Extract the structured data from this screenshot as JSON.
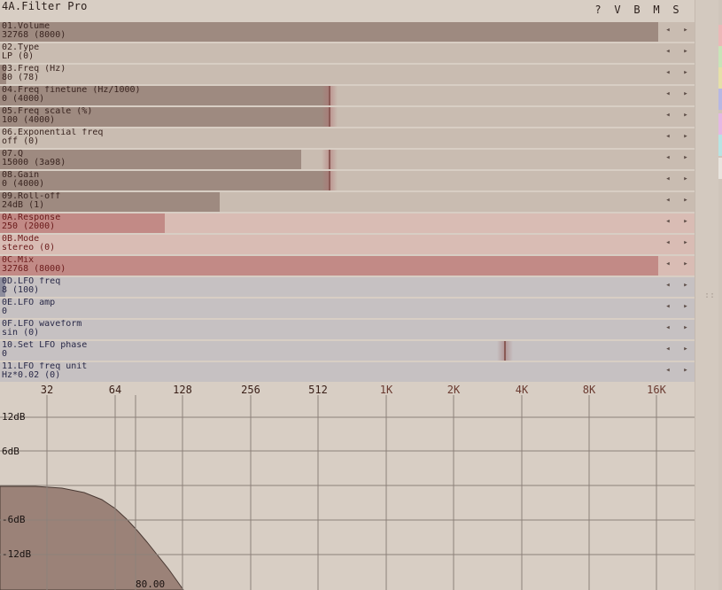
{
  "window": {
    "title": "4A.Filter Pro",
    "buttons": [
      "?",
      "V",
      "B",
      "M",
      "S"
    ]
  },
  "colors": {
    "bg": "#d8cec4",
    "brown_bg": "#c9bcb1",
    "brown_fill": "#9e8a80",
    "red_bg": "#d9bcb4",
    "red_fill": "#c28a86",
    "blue_bg": "#c6c1c2",
    "blue_fill": "#8e8e9e",
    "brown_text": "#3a2520",
    "red_text": "#6a1a1a",
    "blue_text": "#2a2a48",
    "curve": "#9b8278"
  },
  "params": [
    {
      "name": "01.Volume",
      "value": "32768 (8000)",
      "group": "brown",
      "level": 0.948
    },
    {
      "name": "02.Type",
      "value": "LP (0)",
      "group": "brown",
      "level": 0
    },
    {
      "name": "03.Freq (Hz)",
      "value": "80 (78)",
      "group": "brown",
      "level": 0.009
    },
    {
      "name": "04.Freq finetune (Hz/1000)",
      "value": "0 (4000)",
      "group": "brown",
      "level": 0.475,
      "marker": 0.475
    },
    {
      "name": "05.Freq scale (%)",
      "value": "100 (4000)",
      "group": "brown",
      "level": 0.475,
      "marker": 0.475
    },
    {
      "name": "06.Exponential freq",
      "value": "off (0)",
      "group": "brown",
      "level": 0
    },
    {
      "name": "07.Q",
      "value": "15000 (3a98)",
      "group": "brown",
      "level": 0.434,
      "marker": 0.475
    },
    {
      "name": "08.Gain",
      "value": "0 (4000)",
      "group": "brown",
      "level": 0.475,
      "marker": 0.475
    },
    {
      "name": "09.Roll-off",
      "value": "24dB (1)",
      "group": "brown",
      "level": 0.316
    },
    {
      "name": "0A.Response",
      "value": "250 (2000)",
      "group": "red",
      "level": 0.237
    },
    {
      "name": "0B.Mode",
      "value": "stereo (0)",
      "group": "red",
      "level": 0
    },
    {
      "name": "0C.Mix",
      "value": "32768 (8000)",
      "group": "red",
      "level": 0.948
    },
    {
      "name": "0D.LFO freq",
      "value": "8 (100)",
      "group": "blue",
      "level": 0.008
    },
    {
      "name": "0E.LFO amp",
      "value": "0",
      "group": "blue",
      "level": 0
    },
    {
      "name": "0F.LFO waveform",
      "value": "sin (0)",
      "group": "blue",
      "level": 0
    },
    {
      "name": "10.Set LFO phase",
      "value": "0",
      "group": "blue",
      "level": 0,
      "marker": 0.727
    },
    {
      "name": "11.LFO freq unit",
      "value": "Hz*0.02 (0)",
      "group": "blue",
      "level": 0
    }
  ],
  "arrows": {
    "left": "◂",
    "right": "▸"
  },
  "graph": {
    "freq_labels": [
      "32",
      "64",
      "128",
      "256",
      "512",
      "1K",
      "2K",
      "4K",
      "8K",
      "16K"
    ],
    "db_labels": [
      "12dB",
      "6dB",
      "-6dB",
      "-12dB"
    ],
    "cutoff_label": "80.00"
  },
  "swatches": [
    "#ecb8b8",
    "#c8e4b8",
    "#e6e0a8",
    "#b8b8e4",
    "#e4b8e4",
    "#b8e4e4",
    "#e8e4de"
  ]
}
